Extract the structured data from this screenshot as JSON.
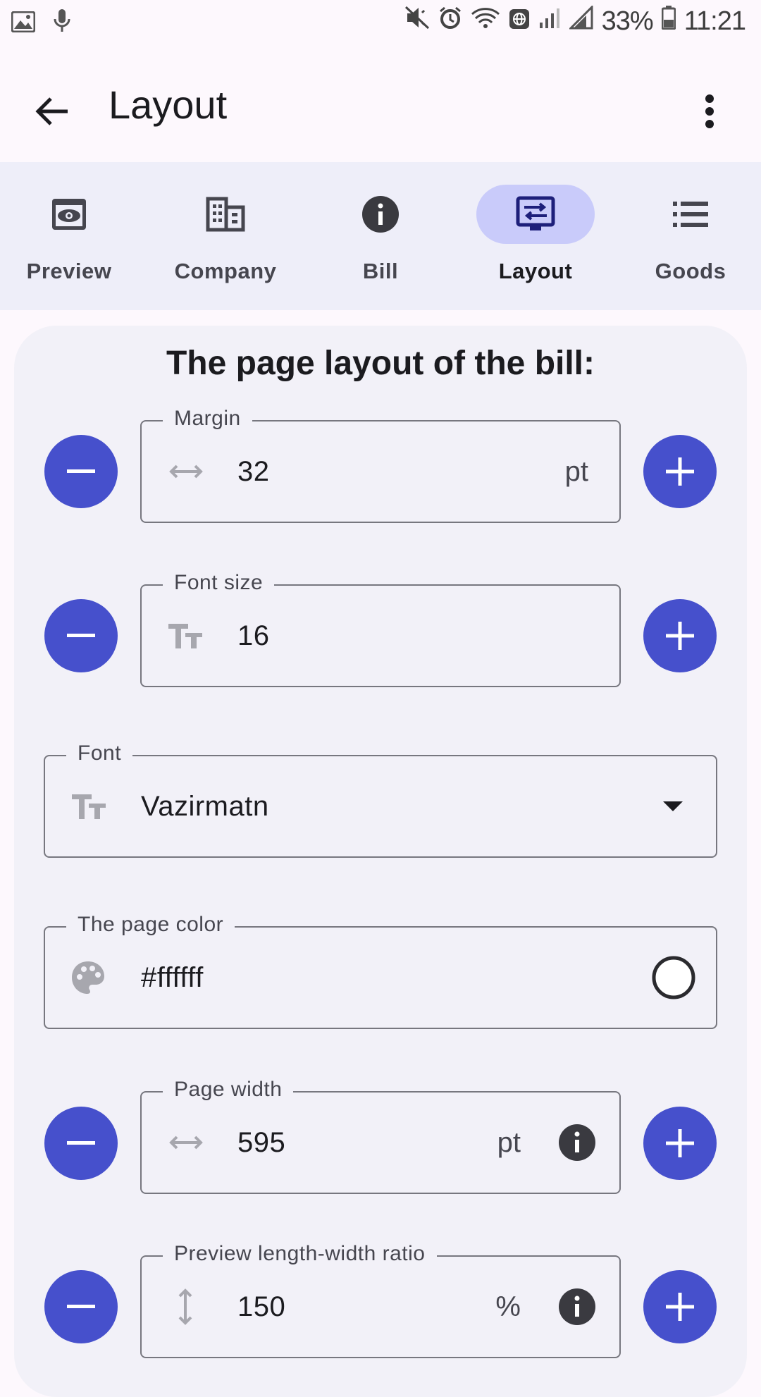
{
  "status_bar": {
    "battery": "33%",
    "time": "11:21"
  },
  "app_bar": {
    "title": "Layout"
  },
  "nav": {
    "items": [
      {
        "label": "Preview",
        "icon": "eye-icon"
      },
      {
        "label": "Company",
        "icon": "building-icon"
      },
      {
        "label": "Bill",
        "icon": "info-icon"
      },
      {
        "label": "Layout",
        "icon": "layout-icon",
        "active": true
      },
      {
        "label": "Goods",
        "icon": "list-icon"
      }
    ]
  },
  "main": {
    "title": "The page layout of the bill:",
    "margin": {
      "label": "Margin",
      "value": "32",
      "unit": "pt"
    },
    "font_size": {
      "label": "Font size",
      "value": "16"
    },
    "font": {
      "label": "Font",
      "value": "Vazirmatn"
    },
    "page_color": {
      "label": "The page color",
      "value": "#ffffff"
    },
    "page_width": {
      "label": "Page width",
      "value": "595",
      "unit": "pt"
    },
    "preview_ratio": {
      "label": "Preview length-width ratio",
      "value": "150",
      "unit": "%"
    }
  },
  "colors": {
    "accent": "#4650cc",
    "nav_background": "#eeeef9",
    "nav_indicator": "#c9cbfa",
    "card_background": "#f2f1f8"
  }
}
